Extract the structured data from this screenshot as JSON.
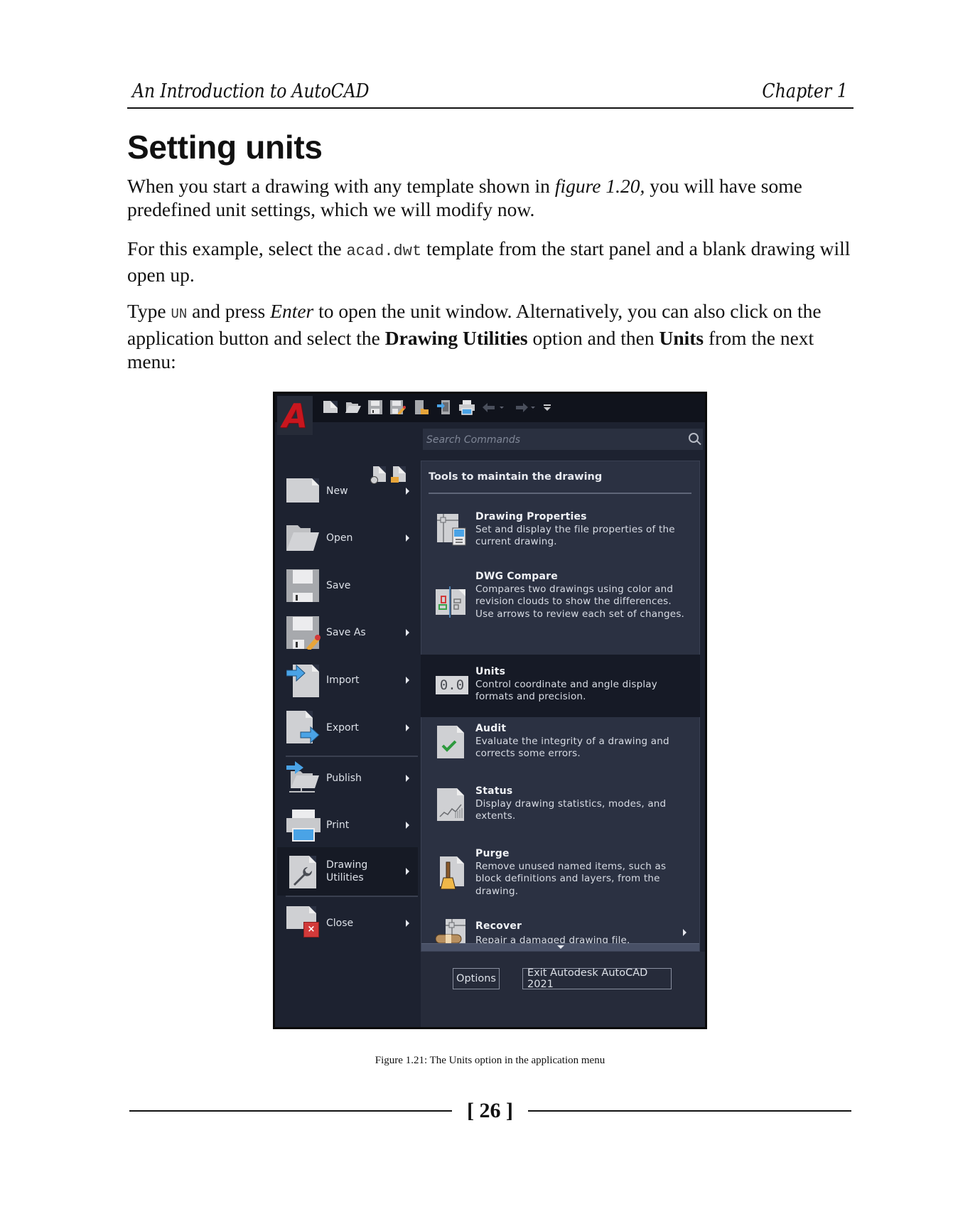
{
  "header": {
    "book_title": "An Introduction to AutoCAD",
    "chapter": "Chapter 1"
  },
  "section_title": "Setting units",
  "paragraphs": {
    "p1": {
      "a": "When you start a drawing with any template shown in ",
      "em": "figure 1.20,",
      "b": " you will have some predefined unit settings, which we will modify now."
    },
    "p2": {
      "a": "For this example, select the ",
      "code": "acad.dwt",
      "b": " template from the start panel and a blank drawing will open up."
    },
    "p3": {
      "a": "Type ",
      "code": "UN",
      "b": " and press ",
      "em": "Enter",
      "c": " to open the unit window. Alternatively, you can also click on the application button and select the ",
      "strong1": "Drawing Utilities",
      "d": " option and then ",
      "strong2": "Units",
      "e": " from the next menu:"
    }
  },
  "app_menu": {
    "logo_letter": "A",
    "quick_access": [
      "new-icon",
      "open-icon",
      "save-icon",
      "save-as-icon",
      "open-from-cloud-icon",
      "save-to-cloud-icon",
      "plot-icon",
      "undo-icon",
      "redo-icon",
      "customize-icon"
    ],
    "search_placeholder": "Search Commands",
    "recent_icons": [
      "recent-documents-icon",
      "open-documents-icon"
    ],
    "left_items": [
      {
        "label": "New",
        "icon": "new-document-icon",
        "has_submenu": true
      },
      {
        "label": "Open",
        "icon": "open-folder-icon",
        "has_submenu": true
      },
      {
        "label": "Save",
        "icon": "save-icon",
        "has_submenu": false
      },
      {
        "label": "Save As",
        "icon": "save-as-icon",
        "has_submenu": true
      },
      {
        "label": "Import",
        "icon": "import-icon",
        "has_submenu": true
      },
      {
        "label": "Export",
        "icon": "export-icon",
        "has_submenu": true
      },
      {
        "label": "Publish",
        "icon": "publish-icon",
        "has_submenu": true
      },
      {
        "label": "Print",
        "icon": "print-icon",
        "has_submenu": true
      },
      {
        "label": "Drawing Utilities",
        "icon": "wrench-document-icon",
        "has_submenu": true,
        "active": true
      },
      {
        "label": "Close",
        "icon": "close-document-icon",
        "has_submenu": true
      }
    ],
    "panel_title": "Tools to maintain the drawing",
    "tools": [
      {
        "name": "Drawing Properties",
        "desc": "Set and display the file properties of the current drawing."
      },
      {
        "name": "DWG Compare",
        "desc": "Compares two drawings using color and revision clouds to show the differences. Use arrows to review each set of changes."
      },
      {
        "name": "Units",
        "desc": "Control coordinate and angle display formats and precision.",
        "icon_text": "0.0",
        "active": true
      },
      {
        "name": "Audit",
        "desc": "Evaluate the integrity of a drawing and corrects some errors."
      },
      {
        "name": "Status",
        "desc": "Display drawing statistics, modes, and extents."
      },
      {
        "name": "Purge",
        "desc": "Remove unused named items, such as block definitions and layers, from the drawing."
      },
      {
        "name": "Recover",
        "desc": "Repair a damaged drawing file.",
        "has_submenu": true
      }
    ],
    "options_button": "Options",
    "exit_button": "Exit Autodesk AutoCAD 2021",
    "colors": {
      "background": "#1d2230",
      "panel": "#2b3142",
      "highlight": "#161a26",
      "logo_red": "#c8161e",
      "accent_blue": "#4aa3e6"
    }
  },
  "caption": "Figure 1.21: The Units option in the application menu",
  "page_number": "[ 26 ]"
}
